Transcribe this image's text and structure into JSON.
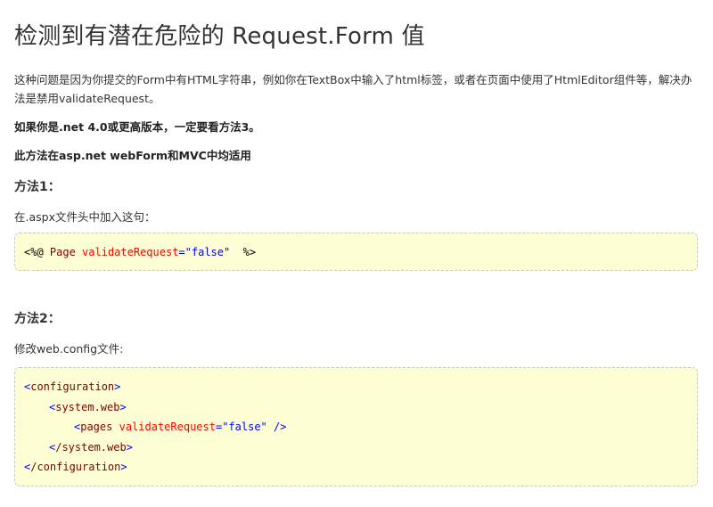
{
  "title": "检测到有潜在危险的 Request.Form 值",
  "intro": "这种问题是因为你提交的Form中有HTML字符串，例如你在TextBox中输入了html标签，或者在页面中使用了HtmlEditor组件等，解决办法是禁用validateRequest。",
  "note_version": "如果你是.net 4.0或更高版本，一定要看方法3。",
  "note_applies": "此方法在asp.net webForm和MVC中均适用",
  "method1": {
    "heading": "方法1：",
    "description": "在.aspx文件头中加入这句：",
    "code": {
      "open": "<%@",
      "directive": " Page ",
      "attr": "validateRequest",
      "eq": "=",
      "value": "\"false\"",
      "close": "  %>"
    }
  },
  "method2": {
    "heading": "方法2：",
    "description": "修改web.config文件:",
    "code": {
      "configuration_open": "configuration",
      "system_web_open": "system.web",
      "pages_tag": "pages",
      "pages_attr": "validateRequest",
      "pages_value": "\"false\"",
      "system_web_close": "/system.web",
      "configuration_close": "/configuration"
    }
  },
  "colors": {
    "code_background": "#fefed4",
    "code_border": "#c8c8c8",
    "tag_color": "#800000",
    "attr_color": "#ff0000",
    "value_color": "#0000ff"
  }
}
